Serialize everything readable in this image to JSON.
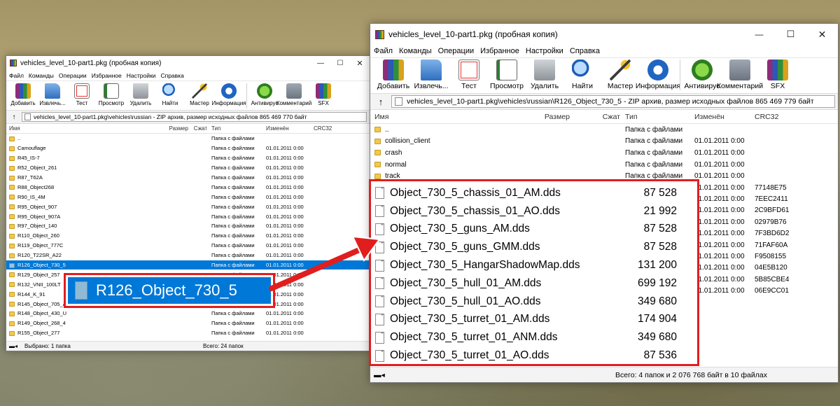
{
  "left_window": {
    "title": "vehicles_level_10-part1.pkg (пробная копия)",
    "menu": [
      "Файл",
      "Команды",
      "Операции",
      "Избранное",
      "Настройки",
      "Справка"
    ],
    "toolbar": [
      "Добавить",
      "Извлечь...",
      "Тест",
      "Просмотр",
      "Удалить",
      "Найти",
      "Мастер",
      "Информация",
      "Антивирус",
      "Комментарий",
      "SFX"
    ],
    "path": "vehicles_level_10-part1.pkg\\vehicles\\russian - ZIP архив, размер исходных файлов 865 469 770 байт",
    "columns": {
      "name": "Имя",
      "size": "Размер",
      "packed": "Сжат",
      "type": "Тип",
      "modified": "Изменён",
      "crc": "CRC32"
    },
    "rows": [
      {
        "name": "..",
        "type": "Папка с файлами",
        "modified": ""
      },
      {
        "name": "Camouflage",
        "type": "Папка с файлами",
        "modified": "01.01.2011 0:00"
      },
      {
        "name": "R45_IS-7",
        "type": "Папка с файлами",
        "modified": "01.01.2011 0:00"
      },
      {
        "name": "R52_Object_261",
        "type": "Папка с файлами",
        "modified": "01.01.2011 0:00"
      },
      {
        "name": "R87_T62A",
        "type": "Папка с файлами",
        "modified": "01.01.2011 0:00"
      },
      {
        "name": "R88_Object268",
        "type": "Папка с файлами",
        "modified": "01.01.2011 0:00"
      },
      {
        "name": "R90_IS_4M",
        "type": "Папка с файлами",
        "modified": "01.01.2011 0:00"
      },
      {
        "name": "R95_Object_907",
        "type": "Папка с файлами",
        "modified": "01.01.2011 0:00"
      },
      {
        "name": "R95_Object_907A",
        "type": "Папка с файлами",
        "modified": "01.01.2011 0:00"
      },
      {
        "name": "R97_Object_140",
        "type": "Папка с файлами",
        "modified": "01.01.2011 0:00"
      },
      {
        "name": "R110_Object_260",
        "type": "Папка с файлами",
        "modified": "01.01.2011 0:00"
      },
      {
        "name": "R119_Object_777C",
        "type": "Папка с файлами",
        "modified": "01.01.2011 0:00"
      },
      {
        "name": "R120_T22SR_A22",
        "type": "Папка с файлами",
        "modified": "01.01.2011 0:00"
      },
      {
        "name": "R126_Object_730_5",
        "type": "Папка с файлами",
        "modified": "01.01.2011 0:00",
        "selected": true
      },
      {
        "name": "R129_Object_257",
        "type": "Папка с файлами",
        "modified": "01.01.2011 0:00"
      },
      {
        "name": "R132_VNII_100LT",
        "type": "Папка с файлами",
        "modified": "01.01.2011 0:00"
      },
      {
        "name": "R144_K_91",
        "type": "Папка с файлами",
        "modified": "01.01.2011 0:00"
      },
      {
        "name": "R145_Object_705_A",
        "type": "Папка с файлами",
        "modified": "01.01.2011 0:00"
      },
      {
        "name": "R148_Object_430_U",
        "type": "Папка с файлами",
        "modified": "01.01.2011 0:00"
      },
      {
        "name": "R149_Object_268_4",
        "type": "Папка с файлами",
        "modified": "01.01.2011 0:00"
      },
      {
        "name": "R155_Object_277",
        "type": "Папка с файлами",
        "modified": "01.01.2011 0:00"
      }
    ],
    "status_left": "Выбрано: 1 папка",
    "status_right": "Всего: 24 папок"
  },
  "callout": {
    "label": "R126_Object_730_5",
    "color": "#e01e1e",
    "highlight": "#0078d7"
  },
  "right_window": {
    "title": "vehicles_level_10-part1.pkg (пробная копия)",
    "menu": [
      "Файл",
      "Команды",
      "Операции",
      "Избранное",
      "Настройки",
      "Справка"
    ],
    "toolbar": [
      "Добавить",
      "Извлечь...",
      "Тест",
      "Просмотр",
      "Удалить",
      "Найти",
      "Мастер",
      "Информация",
      "Антивирус",
      "Комментарий",
      "SFX"
    ],
    "path": "vehicles_level_10-part1.pkg\\vehicles\\russian\\R126_Object_730_5 - ZIP архив, размер исходных файлов 865 469 779 байт",
    "columns": {
      "name": "Имя",
      "size": "Размер",
      "packed": "Сжат",
      "type": "Тип",
      "modified": "Изменён",
      "crc": "CRC32"
    },
    "folders": [
      {
        "name": "..",
        "type": "Папка с файлами",
        "modified": ""
      },
      {
        "name": "collision_client",
        "type": "Папка с файлами",
        "modified": "01.01.2011 0:00"
      },
      {
        "name": "crash",
        "type": "Папка с файлами",
        "modified": "01.01.2011 0:00"
      },
      {
        "name": "normal",
        "type": "Папка с файлами",
        "modified": "01.01.2011 0:00"
      },
      {
        "name": "track",
        "type": "Папка с файлами",
        "modified": "01.01.2011 0:00"
      }
    ],
    "files": [
      {
        "name": "Object_730_5_chassis_01_AM.dds",
        "size": "87 528",
        "modified": "01.01.2011 0:00",
        "crc": "77148E75"
      },
      {
        "name": "Object_730_5_chassis_01_AO.dds",
        "size": "21 992",
        "modified": "01.01.2011 0:00",
        "crc": "7EEC2411"
      },
      {
        "name": "Object_730_5_guns_AM.dds",
        "size": "87 528",
        "modified": "01.01.2011 0:00",
        "crc": "2C9BFD61"
      },
      {
        "name": "Object_730_5_guns_GMM.dds",
        "size": "87 528",
        "modified": "01.01.2011 0:00",
        "crc": "02979B76"
      },
      {
        "name": "Object_730_5_HangarShadowMap.dds",
        "size": "131 200",
        "modified": "01.01.2011 0:00",
        "crc": "7F3BD6D2"
      },
      {
        "name": "Object_730_5_hull_01_AM.dds",
        "size": "699 192",
        "modified": "01.01.2011 0:00",
        "crc": "71FAF60A"
      },
      {
        "name": "Object_730_5_hull_01_AO.dds",
        "size": "349 680",
        "modified": "01.01.2011 0:00",
        "crc": "F9508155"
      },
      {
        "name": "Object_730_5_turret_01_AM.dds",
        "size": "174 904",
        "modified": "01.01.2011 0:00",
        "crc": "04E5B120"
      },
      {
        "name": "Object_730_5_turret_01_ANM.dds",
        "size": "349 680",
        "modified": "01.01.2011 0:00",
        "crc": "5B85CBE4"
      },
      {
        "name": "Object_730_5_turret_01_AO.dds",
        "size": "87 536",
        "modified": "01.01.2011 0:00",
        "crc": "06E9CC01"
      }
    ],
    "status": "Всего: 4 папок и 2 076 768 байт в 10 файлах"
  }
}
